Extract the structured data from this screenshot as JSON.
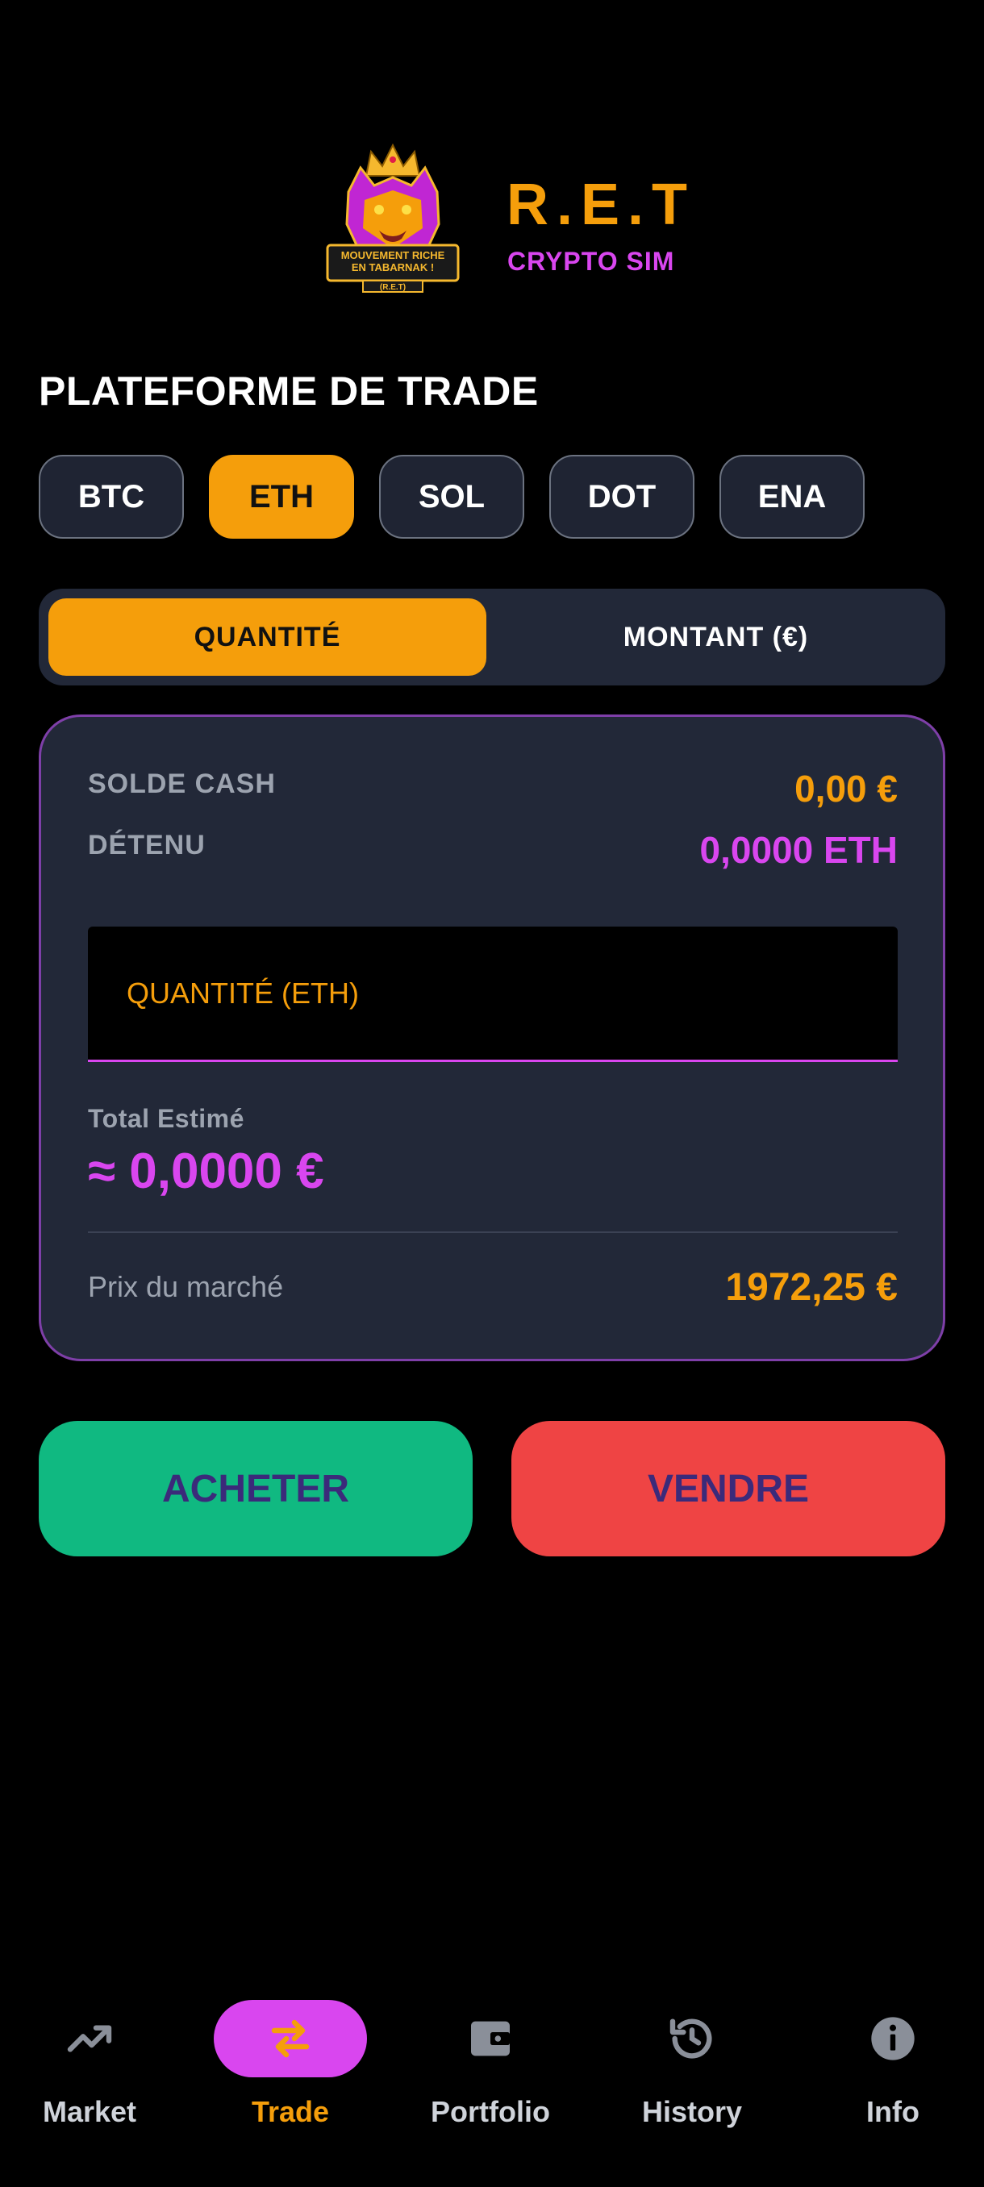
{
  "brand": {
    "title": "R.E.T",
    "subtitle": "CRYPTO SIM"
  },
  "logo": {
    "text_lines": [
      "MOUVEMENT RICHE",
      "EN TABARNAK !",
      "(R.E.T)"
    ]
  },
  "page_title": "PLATEFORME DE TRADE",
  "coins": [
    {
      "label": "BTC",
      "active": false
    },
    {
      "label": "ETH",
      "active": true
    },
    {
      "label": "SOL",
      "active": false
    },
    {
      "label": "DOT",
      "active": false
    },
    {
      "label": "ENA",
      "active": false
    }
  ],
  "mode": {
    "quantity": "QUANTITÉ",
    "amount": "MONTANT (€)"
  },
  "card": {
    "cash_label": "SOLDE CASH",
    "cash_value": "0,00 €",
    "held_label": "DÉTENU",
    "held_value": "0,0000 ETH",
    "input_placeholder": "QUANTITÉ (ETH)",
    "total_label": "Total Estimé",
    "total_value": "≈ 0,0000 €",
    "market_label": "Prix du marché",
    "market_value": "1972,25 €"
  },
  "actions": {
    "buy": "ACHETER",
    "sell": "VENDRE"
  },
  "nav": [
    {
      "label": "Market",
      "icon": "trending-up-icon",
      "active": false
    },
    {
      "label": "Trade",
      "icon": "swap-arrows-icon",
      "active": true
    },
    {
      "label": "Portfolio",
      "icon": "wallet-icon",
      "active": false
    },
    {
      "label": "History",
      "icon": "history-icon",
      "active": false
    },
    {
      "label": "Info",
      "icon": "info-icon",
      "active": false
    }
  ],
  "colors": {
    "accent": "#f59e0b",
    "secondary": "#d946ef",
    "buy": "#10b981",
    "sell": "#ef4444",
    "card": "#222838"
  }
}
